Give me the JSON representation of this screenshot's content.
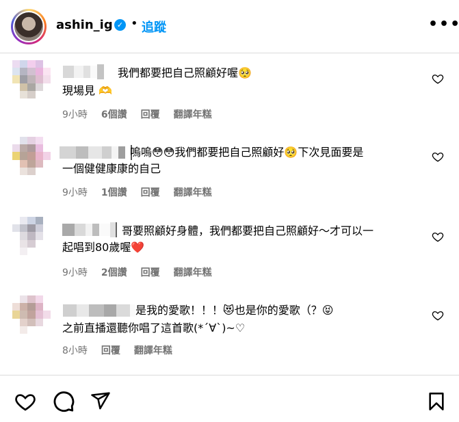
{
  "header": {
    "username": "ashin_ig",
    "separator": "•",
    "follow_label": "追蹤",
    "more_label": "•••"
  },
  "comments": [
    {
      "text_parts": [
        "我們都要把自己照顧好喔",
        "🥹",
        "\n現場見",
        "🫶🏻"
      ],
      "line1": "我們都要把自己照顧好喔",
      "line2": "現場見",
      "time": "9小時",
      "likes": "6個讚",
      "reply": "回覆",
      "translate": "翻譯年糕"
    },
    {
      "line1": "嗚嗚",
      "line1b": "我們都要把自己照顧好",
      "line1c": "下次見面要是",
      "line2": "一個健健康康的自己",
      "time": "9小時",
      "likes": "1個讚",
      "reply": "回覆",
      "translate": "翻譯年糕"
    },
    {
      "line1": "哥要照顧好身體，我們都要把自己照顧好～才可以一",
      "line2": "起唱到80歲喔",
      "time": "9小時",
      "likes": "2個讚",
      "reply": "回覆",
      "translate": "翻譯年糕"
    },
    {
      "line1": "是我的愛歌！！！",
      "line1b": "也是你的愛歌（？",
      "line2": "之前直播還聽你唱了這首歌(*´∀`)~♡",
      "time": "8小時",
      "reply": "回覆",
      "translate": "翻譯年糕"
    }
  ],
  "icons": {
    "like": "heart-icon",
    "comment": "comment-icon",
    "share": "paper-plane-icon",
    "save": "bookmark-icon"
  },
  "colors": {
    "accent": "#0095f6",
    "meta_text": "#737373",
    "heart_red": "#ed4956",
    "divider": "#dbdbdb"
  }
}
